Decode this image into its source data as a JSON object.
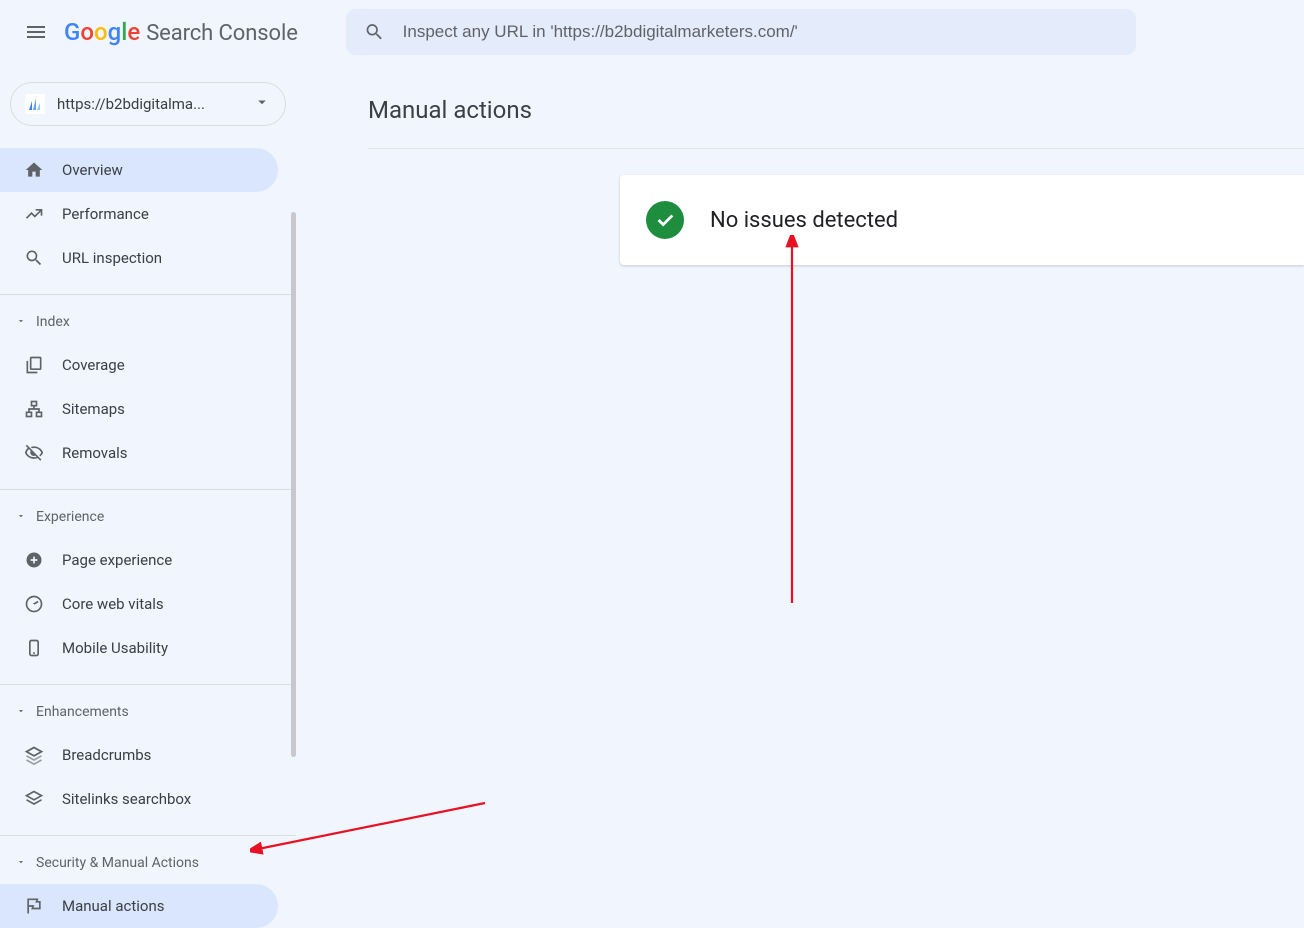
{
  "header": {
    "logo_product": "Search Console",
    "search_placeholder": "Inspect any URL in 'https://b2bdigitalmarketers.com/'"
  },
  "property_picker": {
    "label": "https://b2bdigitalma..."
  },
  "sidebar": {
    "items": [
      {
        "label": "Overview"
      },
      {
        "label": "Performance"
      },
      {
        "label": "URL inspection"
      }
    ],
    "index_header": "Index",
    "index_items": [
      {
        "label": "Coverage"
      },
      {
        "label": "Sitemaps"
      },
      {
        "label": "Removals"
      }
    ],
    "experience_header": "Experience",
    "experience_items": [
      {
        "label": "Page experience"
      },
      {
        "label": "Core web vitals"
      },
      {
        "label": "Mobile Usability"
      }
    ],
    "enhancements_header": "Enhancements",
    "enhancements_items": [
      {
        "label": "Breadcrumbs"
      },
      {
        "label": "Sitelinks searchbox"
      }
    ],
    "security_header": "Security & Manual Actions",
    "security_items": [
      {
        "label": "Manual actions"
      }
    ]
  },
  "main": {
    "title": "Manual actions",
    "status_message": "No issues detected"
  }
}
